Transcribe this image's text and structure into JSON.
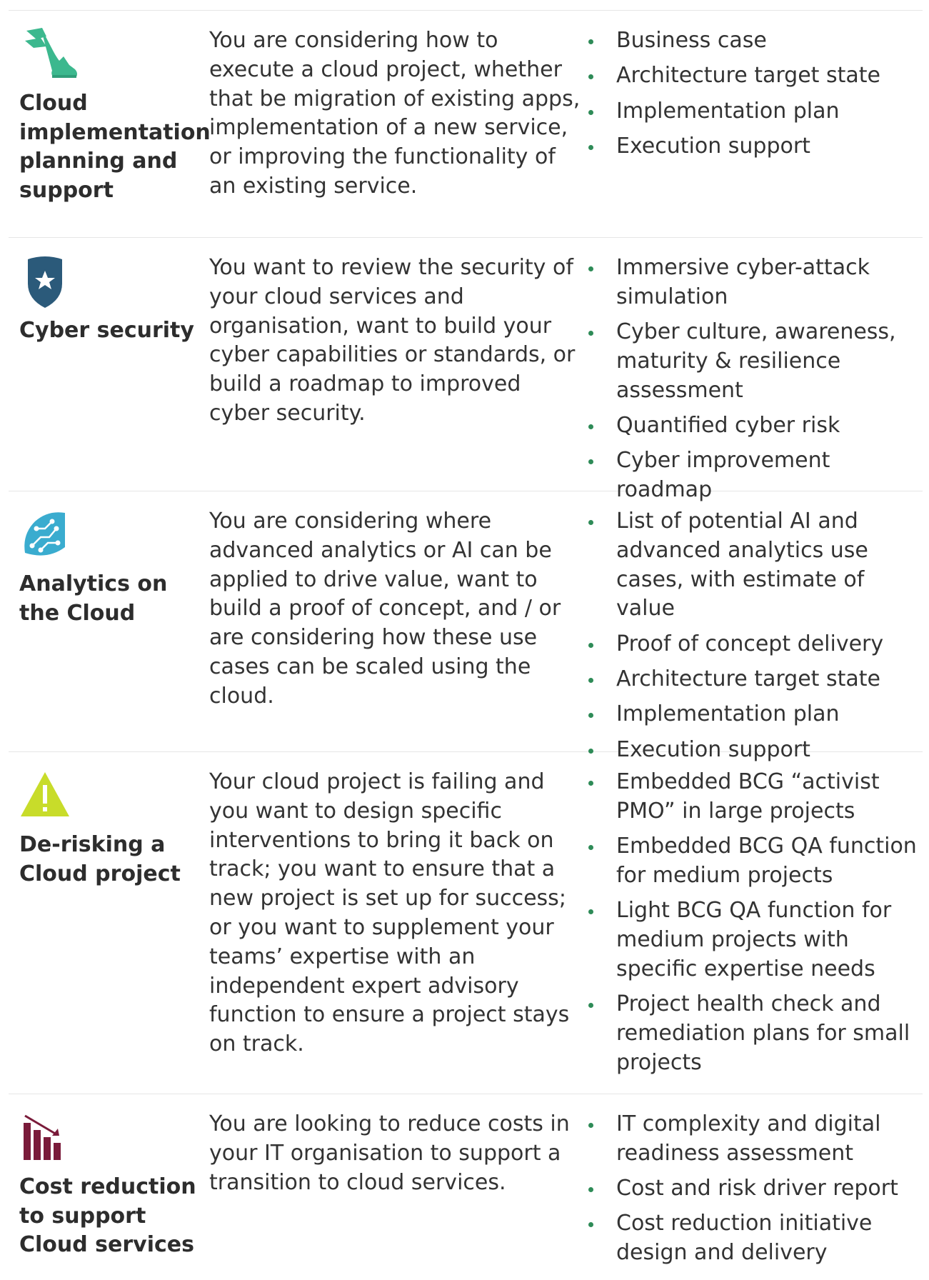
{
  "rows": [
    {
      "icon": "running-shoe-icon",
      "title": "Cloud implementation planning and support",
      "description": "You are considering how to execute a cloud project, whether that be migration of existing apps, implementation of a new service, or improving the functionality of an existing service.",
      "bullets": [
        "Business case",
        "Architecture target state",
        "Implementation plan",
        "Execution support"
      ]
    },
    {
      "icon": "shield-star-icon",
      "title": "Cyber security",
      "description": "You want to review the security of your cloud services and organisation, want to build your cyber capabilities or standards, or build a roadmap to improved cyber security.",
      "bullets": [
        "Immersive cyber-attack simulation",
        "Cyber culture, awareness, maturity & resilience assessment",
        "Quantified cyber risk",
        "Cyber improvement roadmap"
      ]
    },
    {
      "icon": "circuit-brain-icon",
      "title": "Analytics on the Cloud",
      "description": "You are considering where advanced analytics or AI can be applied to drive value, want to build a proof of concept, and / or are considering how these use cases can be scaled using the cloud.",
      "bullets": [
        "List of potential AI and advanced analytics use cases, with estimate of value",
        "Proof of concept delivery",
        "Architecture target state",
        "Implementation plan",
        "Execution support"
      ]
    },
    {
      "icon": "warning-triangle-icon",
      "title": "De-risking a Cloud project",
      "description": "Your cloud project is failing and you want to design specific interventions to bring it back on track; you want to ensure that a new project is set up for success; or you want to supplement your teams’ expertise with an independent expert advisory function to ensure a project stays on track.",
      "bullets": [
        "Embedded BCG “activist PMO” in large projects",
        "Embedded BCG QA function for medium projects",
        "Light BCG QA function for medium projects with specific expertise needs",
        "Project health check and remediation plans for small projects"
      ]
    },
    {
      "icon": "declining-bar-chart-icon",
      "title": "Cost reduction to support Cloud services",
      "description": "You are looking to reduce costs in your IT organisation to support a transition to cloud services.",
      "bullets": [
        "IT complexity and digital readiness assessment",
        "Cost and risk driver report",
        "Cost reduction initiative design and delivery"
      ]
    }
  ],
  "colors": {
    "shoe": "#3cb88e",
    "shield": "#2b5a7a",
    "brain": "#3aaccf",
    "warning": "#c8dc2a",
    "cost": "#7a1b3a",
    "bullet": "#2e8b57"
  }
}
